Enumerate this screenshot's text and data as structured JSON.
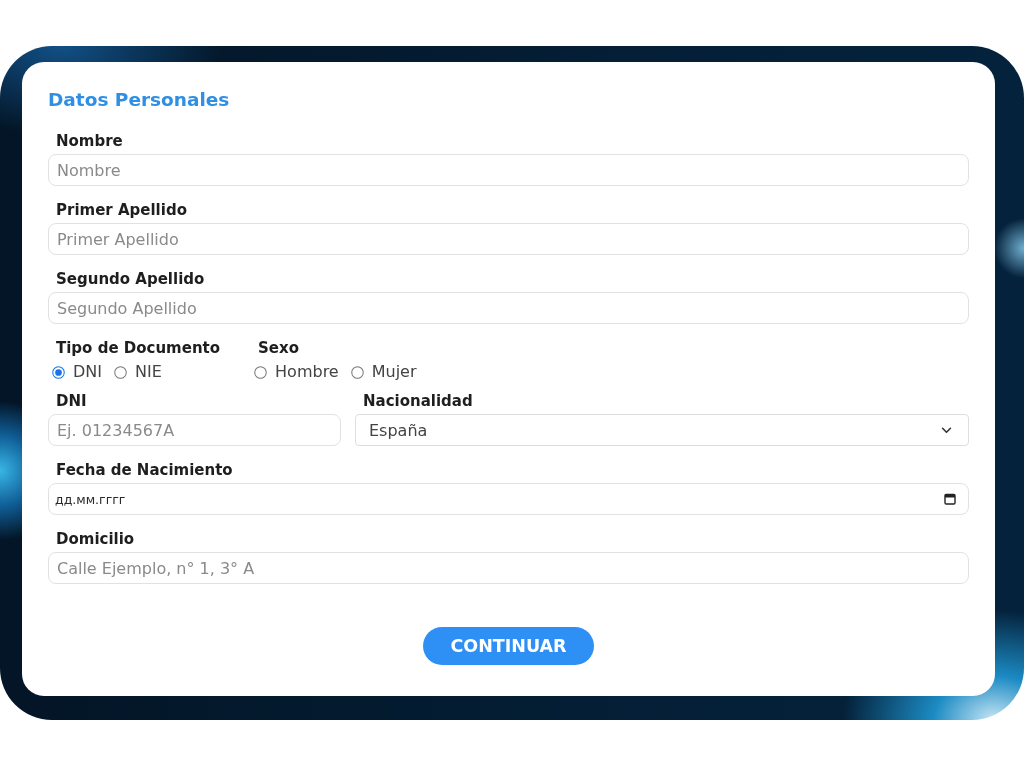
{
  "form": {
    "title": "Datos Personales",
    "rows": [
      {
        "kind": "fields",
        "fields": [
          {
            "kind": "text",
            "label": "Nombre",
            "placeholder": "Nombre"
          }
        ]
      },
      {
        "kind": "fields",
        "fields": [
          {
            "kind": "text",
            "label": "Primer Apellido",
            "placeholder": "Primer Apellido"
          }
        ]
      },
      {
        "kind": "fields",
        "fields": [
          {
            "kind": "text",
            "label": "Segundo Apellido",
            "placeholder": "Segundo Apellido"
          }
        ]
      },
      {
        "kind": "radio_groups",
        "groups": [
          {
            "label": "Tipo de Documento",
            "options": [
              {
                "label": "DNI",
                "selected": true
              },
              {
                "label": "NIE",
                "selected": false
              }
            ]
          },
          {
            "label": "Sexo",
            "options": [
              {
                "label": "Hombre",
                "selected": false
              },
              {
                "label": "Mujer",
                "selected": false
              }
            ]
          }
        ]
      },
      {
        "kind": "fields",
        "fields": [
          {
            "kind": "text",
            "label": "DNI",
            "placeholder": "Ej. 01234567A"
          },
          {
            "kind": "select",
            "label": "Nacionalidad",
            "value": "España"
          }
        ]
      },
      {
        "kind": "fields",
        "fields": [
          {
            "kind": "date",
            "label": "Fecha de Nacimiento",
            "placeholder": "дд.мм.гггг"
          }
        ]
      },
      {
        "kind": "fields",
        "fields": [
          {
            "kind": "text",
            "label": "Domicilio",
            "placeholder": "Calle Ejemplo, n° 1, 3° A"
          }
        ]
      }
    ],
    "button": {
      "label": "CONTINUAR"
    }
  }
}
